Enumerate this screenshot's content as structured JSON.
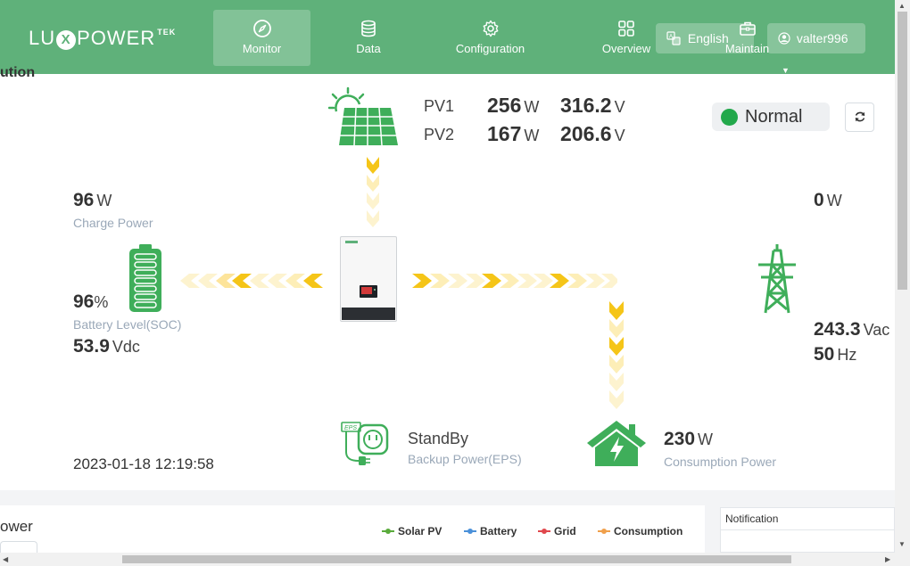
{
  "header": {
    "logo_pre": "LU",
    "logo_x": "X",
    "logo_post": "POWER",
    "logo_sup": "TEK",
    "nav": [
      {
        "label": "Monitor",
        "icon": "compass-icon",
        "active": true
      },
      {
        "label": "Data",
        "icon": "database-icon",
        "active": false
      },
      {
        "label": "Configuration",
        "icon": "gear-icon",
        "active": false
      },
      {
        "label": "Overview",
        "icon": "grid-icon",
        "active": false
      },
      {
        "label": "Maintain",
        "icon": "toolbox-icon",
        "active": false
      }
    ],
    "language": "English",
    "user": "valter996"
  },
  "panel": {
    "clipped_title": "ution",
    "pv": [
      {
        "label": "PV1",
        "power": "256",
        "power_unit": "W",
        "voltage": "316.2",
        "voltage_unit": "V"
      },
      {
        "label": "PV2",
        "power": "167",
        "power_unit": "W",
        "voltage": "206.6",
        "voltage_unit": "V"
      }
    ],
    "status": "Normal",
    "status_color": "#22a84b",
    "battery": {
      "charge_power": "96",
      "charge_power_unit": "W",
      "charge_label": "Charge Power",
      "soc": "96",
      "soc_unit": "%",
      "soc_label": "Battery Level(SOC)",
      "voltage": "53.9",
      "voltage_unit": "Vdc"
    },
    "grid": {
      "power": "0",
      "power_unit": "W",
      "voltage": "243.3",
      "voltage_unit": "Vac",
      "frequency": "50",
      "frequency_unit": "Hz"
    },
    "eps": {
      "status": "StandBy",
      "label": "Backup Power(EPS)"
    },
    "consumption": {
      "power": "230",
      "power_unit": "W",
      "label": "Consumption Power"
    },
    "timestamp": "2023-01-18 12:19:58"
  },
  "bottom": {
    "power_title": "ower",
    "legend": [
      {
        "label": "Solar PV",
        "color": "#5aab3c"
      },
      {
        "label": "Battery",
        "color": "#4a90d9"
      },
      {
        "label": "Grid",
        "color": "#e0474c"
      },
      {
        "label": "Consumption",
        "color": "#f0a04b"
      }
    ],
    "notification_title": "Notification"
  },
  "colors": {
    "header_green": "#5fb17a",
    "icon_green": "#3fae5a",
    "flow_yellow": "#f5c518"
  }
}
